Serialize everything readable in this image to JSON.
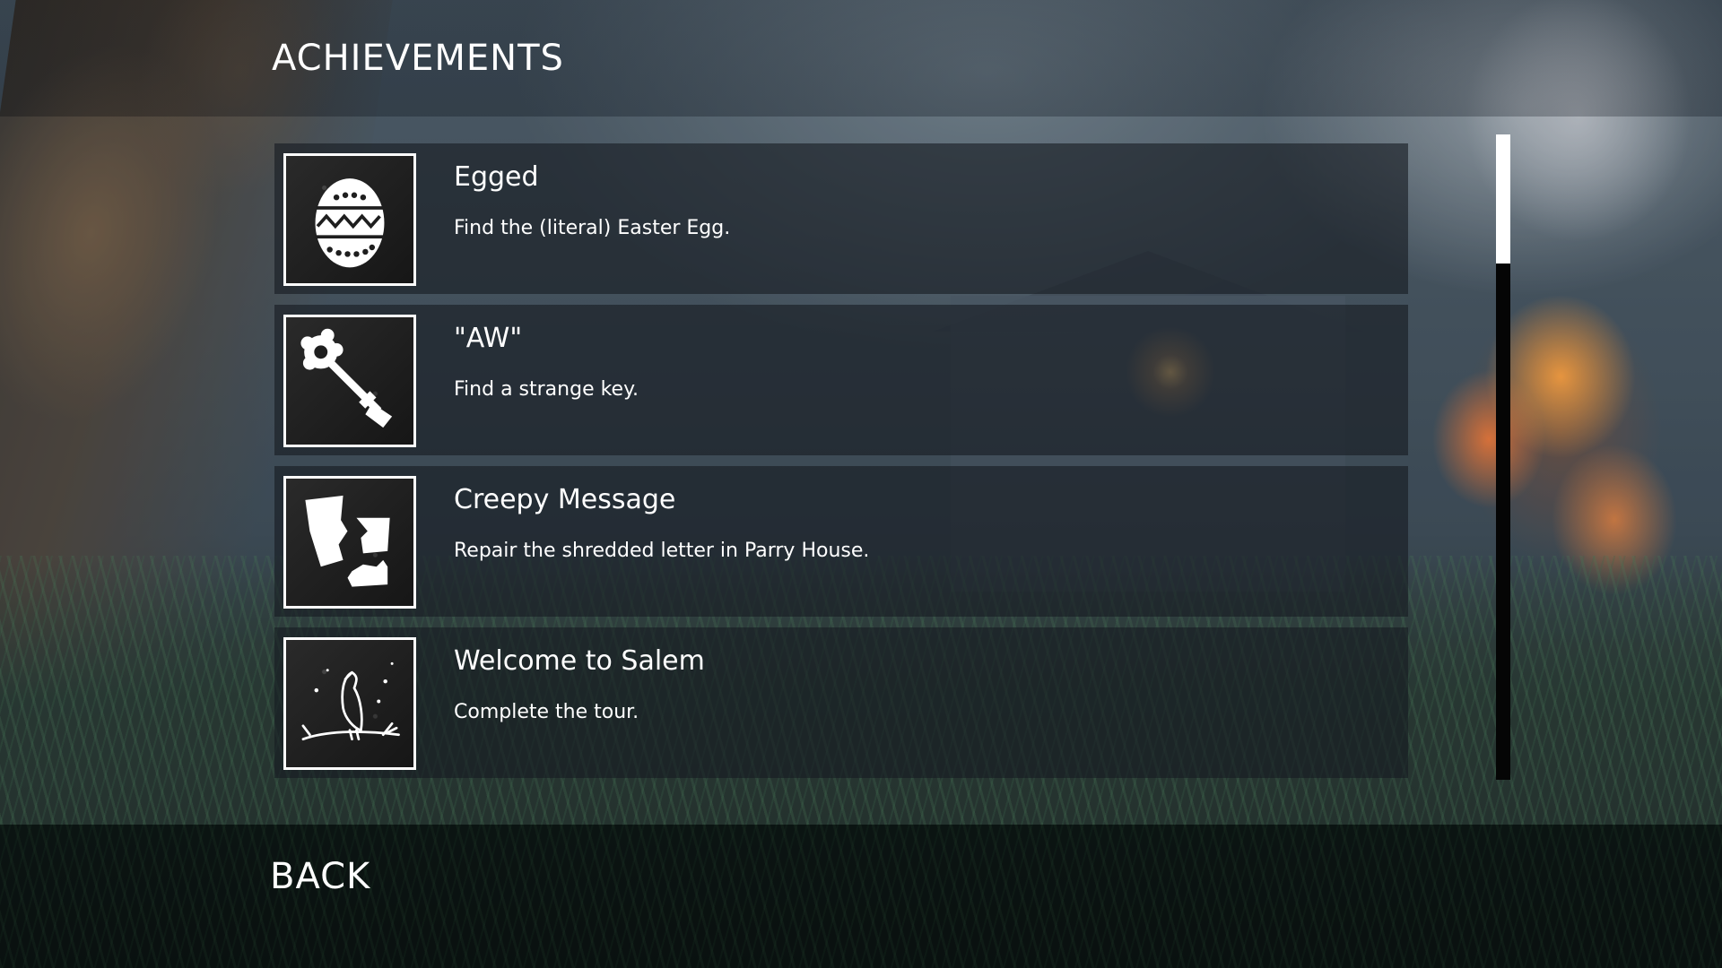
{
  "header": {
    "title": "ACHIEVEMENTS"
  },
  "achievements": [
    {
      "title": "Egged",
      "description": "Find the (literal) Easter Egg.",
      "icon": "easter-egg-icon"
    },
    {
      "title": "\"AW\"",
      "description": "Find a strange key.",
      "icon": "skeleton-key-icon"
    },
    {
      "title": "Creepy Message",
      "description": "Repair the shredded letter in Parry House.",
      "icon": "torn-letter-icon"
    },
    {
      "title": "Welcome to Salem",
      "description": "Complete the tour.",
      "icon": "crow-on-branch-icon"
    }
  ],
  "scrollbar": {
    "position_fraction": 0.0,
    "visible_fraction": 0.2
  },
  "footer": {
    "back_label": "BACK"
  },
  "colors": {
    "text": "#ffffff",
    "card_bg": "#161c22",
    "scroll_thumb": "#ffffff",
    "scroll_track": "#050505"
  }
}
